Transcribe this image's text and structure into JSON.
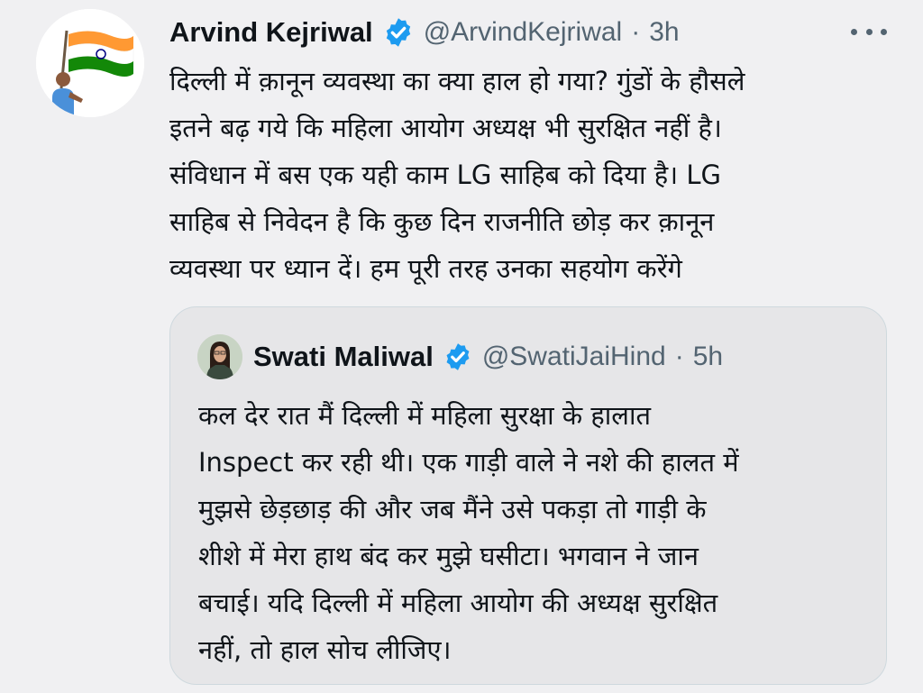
{
  "tweet": {
    "author": {
      "name": "Arvind Kejriwal",
      "handle": "@ArvindKejriwal",
      "avatar_icon": "profile-photo-with-flag-icon",
      "verified_icon": "verified-badge-icon"
    },
    "dot": "·",
    "time": "3h",
    "more_icon": "more-options-icon",
    "text": "दिल्ली में क़ानून व्यवस्था का क्या हाल हो गया? गुंडों के हौसले\nइतने बढ़ गये कि महिला आयोग अध्यक्ष भी सुरक्षित नहीं है।\nसंविधान में बस एक यही काम LG साहिब को दिया है। LG\nसाहिब से निवेदन है कि कुछ दिन राजनीति छोड़ कर क़ानून\nव्यवस्था पर ध्यान दें। हम पूरी तरह उनका सहयोग करेंगे"
  },
  "quote": {
    "author": {
      "name": "Swati Maliwal",
      "handle": "@SwatiJaiHind",
      "avatar_icon": "profile-photo-icon",
      "verified_icon": "verified-badge-icon"
    },
    "dot": "·",
    "time": "5h",
    "text": "कल देर रात मैं दिल्ली में महिला सुरक्षा के हालात\nInspect कर रही थी। एक गाड़ी वाले ने नशे की हालत में\nमुझसे छेड़छाड़ की और जब मैंने उसे पकड़ा तो गाड़ी के\nशीशे में मेरा हाथ बंद कर मुझे घसीटा। भगवान ने जान\nबचाई। यदि दिल्ली में महिला आयोग की अध्यक्ष सुरक्षित\nनहीं, तो हाल सोच लीजिए।"
  },
  "colors": {
    "background": "#f0f0f2",
    "quote_background": "#e6e6e8",
    "verified_blue": "#1d9bf0",
    "secondary_text": "#536471",
    "primary_text": "#0f1419"
  }
}
